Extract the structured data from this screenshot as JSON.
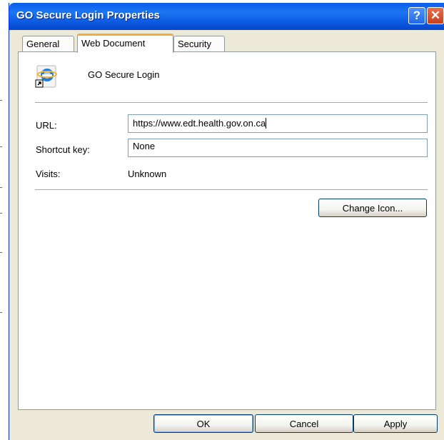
{
  "window": {
    "title": "GO Secure Login Properties",
    "help_glyph": "?",
    "close_glyph": "✕"
  },
  "tabs": [
    {
      "label": "General",
      "active": false
    },
    {
      "label": "Web Document",
      "active": true
    },
    {
      "label": "Security",
      "active": false
    }
  ],
  "document": {
    "icon": "internet-shortcut-icon",
    "name": "GO Secure Login"
  },
  "fields": {
    "url_label": "URL:",
    "url_value": "https://www.edt.health.gov.on.ca",
    "shortcut_label": "Shortcut key:",
    "shortcut_value": "None",
    "visits_label": "Visits:",
    "visits_value": "Unknown"
  },
  "buttons": {
    "change_icon": "Change Icon...",
    "ok": "OK",
    "cancel": "Cancel",
    "apply": "Apply"
  },
  "colors": {
    "titlebar": "#0a5ee9",
    "active_tab_accent": "#f5a93c",
    "dialog_bg": "#ece9d8"
  }
}
